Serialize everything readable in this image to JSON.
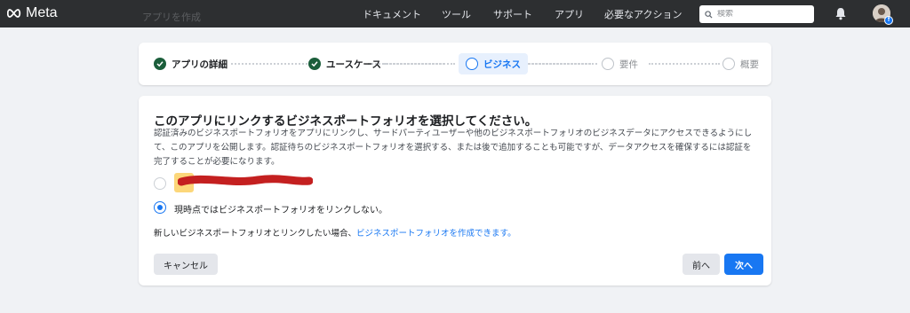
{
  "nav": {
    "logo_text": "Meta",
    "items": [
      "ドキュメント",
      "ツール",
      "サポート",
      "アプリ",
      "必要なアクション"
    ],
    "search_placeholder": "検索",
    "ghost_title": "アプリを作成"
  },
  "stepper": {
    "steps": [
      {
        "label": "アプリの詳細",
        "state": "done"
      },
      {
        "label": "ユースケース",
        "state": "done"
      },
      {
        "label": "ビジネス",
        "state": "active"
      },
      {
        "label": "要件",
        "state": "pending"
      },
      {
        "label": "概要",
        "state": "pending"
      }
    ]
  },
  "card": {
    "title": "このアプリにリンクするビジネスポートフォリオを選択してください。",
    "description": "認証済みのビジネスポートフォリオをアプリにリンクし、サードパーティユーザーや他のビジネスポートフォリオのビジネスデータにアクセスできるようにして、このアプリを公開します。認証待ちのビジネスポートフォリオを選択する、または後で追加することも可能ですが、データアクセスを確保するには認証を完了することが必要になります。",
    "option_none_label": "現時点ではビジネスポートフォリオをリンクしない。",
    "selected_option": "none",
    "footnote_prefix": "新しいビジネスポートフォリオとリンクしたい場合、",
    "footnote_link": "ビジネスポートフォリオを作成できます。"
  },
  "buttons": {
    "cancel": "キャンセル",
    "back": "前へ",
    "next": "次へ"
  },
  "colors": {
    "accent": "#1877f2",
    "done_green": "#1b5e3b",
    "nav_bg": "#2d2f31"
  }
}
